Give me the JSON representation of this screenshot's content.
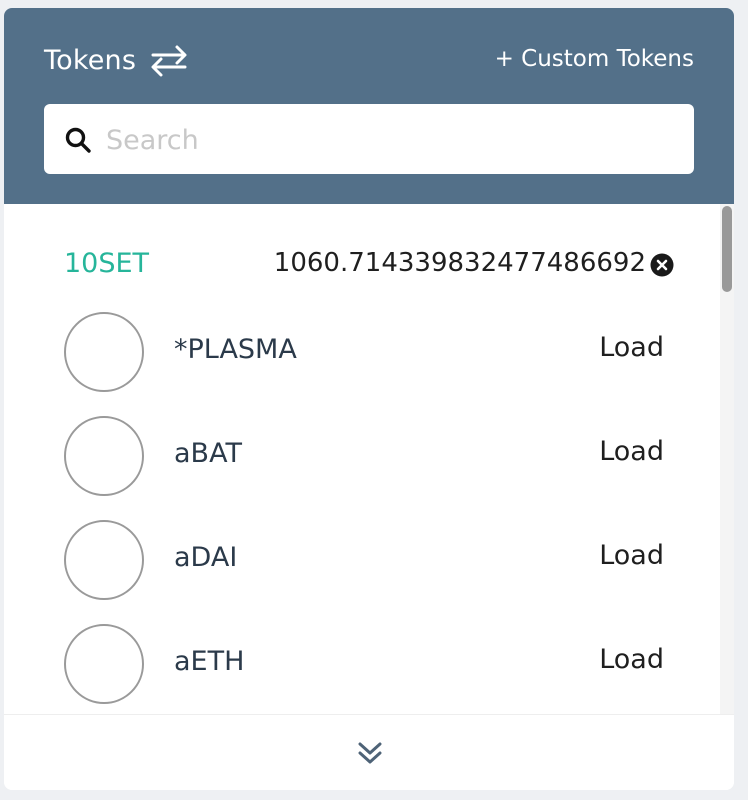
{
  "header": {
    "title": "Tokens",
    "swap_icon": "swap-arrows-icon",
    "custom_tokens_label": "+ Custom Tokens"
  },
  "search": {
    "placeholder": "Search",
    "value": "",
    "icon": "search-icon"
  },
  "balance": {
    "symbol": "10SET",
    "amount": "1060.714339832477486692",
    "remove_icon": "remove-circle-icon"
  },
  "tokens": [
    {
      "name": "*PLASMA",
      "action": "Load"
    },
    {
      "name": "aBAT",
      "action": "Load"
    },
    {
      "name": "aDAI",
      "action": "Load"
    },
    {
      "name": "aETH",
      "action": "Load"
    }
  ],
  "footer": {
    "expand_icon": "double-chevron-down-icon"
  },
  "colors": {
    "header_bg": "#537089",
    "balance_symbol": "#26b59a",
    "token_name": "#2b3a4a"
  }
}
